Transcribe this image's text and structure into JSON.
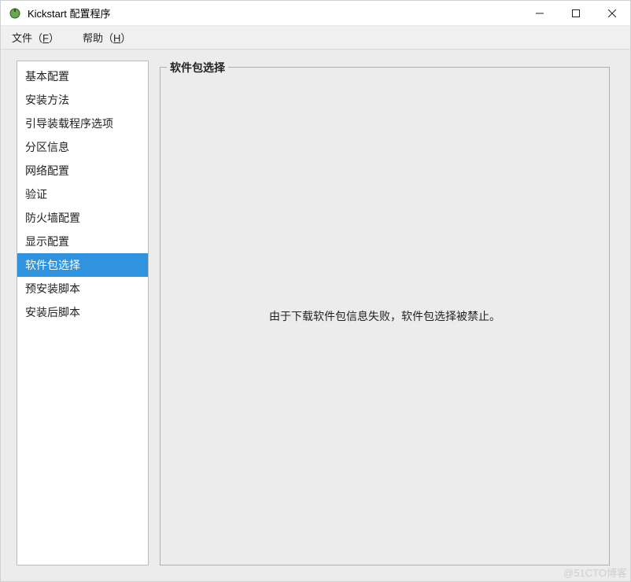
{
  "titlebar": {
    "title": "Kickstart 配置程序"
  },
  "menubar": {
    "file": {
      "label": "文件",
      "accel": "（F）",
      "underline": "F"
    },
    "help": {
      "label": "帮助",
      "accel": "（H）",
      "underline": "H"
    }
  },
  "sidebar": {
    "items": [
      {
        "label": "基本配置",
        "selected": false
      },
      {
        "label": "安装方法",
        "selected": false
      },
      {
        "label": "引导装载程序选项",
        "selected": false
      },
      {
        "label": "分区信息",
        "selected": false
      },
      {
        "label": "网络配置",
        "selected": false
      },
      {
        "label": "验证",
        "selected": false
      },
      {
        "label": "防火墙配置",
        "selected": false
      },
      {
        "label": "显示配置",
        "selected": false
      },
      {
        "label": "软件包选择",
        "selected": true
      },
      {
        "label": "预安装脚本",
        "selected": false
      },
      {
        "label": "安装后脚本",
        "selected": false
      }
    ]
  },
  "content": {
    "group_title": "软件包选择",
    "message": "由于下载软件包信息失败，软件包选择被禁止。"
  },
  "watermark": "@51CTO博客"
}
